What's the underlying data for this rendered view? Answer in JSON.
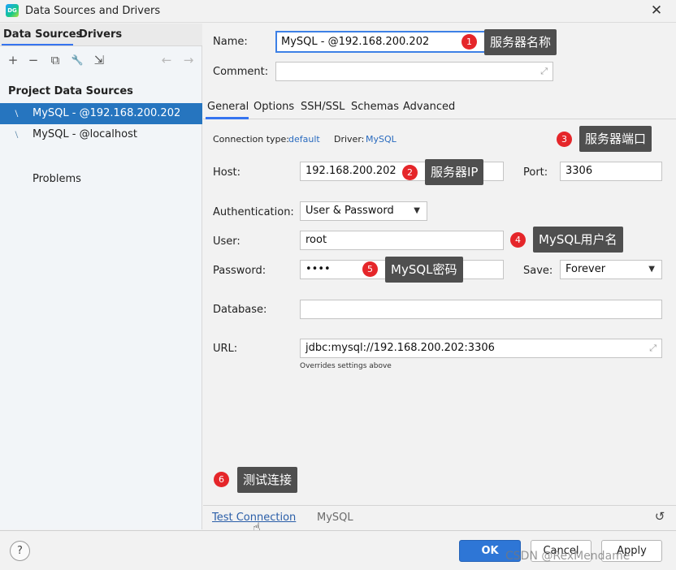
{
  "window": {
    "logo_text": "DG",
    "title": "Data Sources and Drivers",
    "close_glyph": "✕"
  },
  "left": {
    "tabs": [
      "Data Sources",
      "Drivers"
    ],
    "toolbar": {
      "add": "+",
      "remove": "−",
      "copy": "⧉",
      "settings": "🔧",
      "import": "⇲",
      "back": "←",
      "forward": "→"
    },
    "section": "Project Data Sources",
    "items": [
      {
        "label": "MySQL - @192.168.200.202",
        "icon": "mysql-dolphin-icon",
        "selected": true
      },
      {
        "label": "MySQL - @localhost",
        "icon": "mysql-dolphin-icon",
        "selected": false
      }
    ],
    "problems": "Problems"
  },
  "form": {
    "name_label": "Name:",
    "name_value": "MySQL - @192.168.200.202",
    "comment_label": "Comment:",
    "comment_value": "",
    "tabs": [
      "General",
      "Options",
      "SSH/SSL",
      "Schemas",
      "Advanced"
    ],
    "active_tab": "General",
    "conn_type_label": "Connection type:",
    "conn_type_value": "default",
    "driver_label": "Driver:",
    "driver_value": "MySQL",
    "host_label": "Host:",
    "host_value": "192.168.200.202",
    "port_label": "Port:",
    "port_value": "3306",
    "auth_label": "Authentication:",
    "auth_value": "User & Password",
    "user_label": "User:",
    "user_value": "root",
    "password_label": "Password:",
    "password_value": "••••",
    "save_label": "Save:",
    "save_value": "Forever",
    "database_label": "Database:",
    "database_value": "",
    "url_label": "URL:",
    "url_value": "jdbc:mysql://192.168.200.202:3306",
    "url_hint": "Overrides settings above"
  },
  "bottom": {
    "test_connection": "Test Connection",
    "driver": "MySQL"
  },
  "footer": {
    "help": "?",
    "ok": "OK",
    "cancel": "Cancel",
    "apply": "Apply",
    "watermark": "CSDN @RexMendame"
  },
  "annotations": [
    {
      "num": "1",
      "text": "服务器名称"
    },
    {
      "num": "2",
      "text": "服务器IP"
    },
    {
      "num": "3",
      "text": "服务器端口"
    },
    {
      "num": "4",
      "text": "MySQL用户名"
    },
    {
      "num": "5",
      "text": "MySQL密码"
    },
    {
      "num": "6",
      "text": "测试连接"
    }
  ],
  "colors": {
    "accent": "#3574f0",
    "selection": "#2675bf",
    "badge": "#e5262a",
    "callout": "#4f4f4f"
  }
}
